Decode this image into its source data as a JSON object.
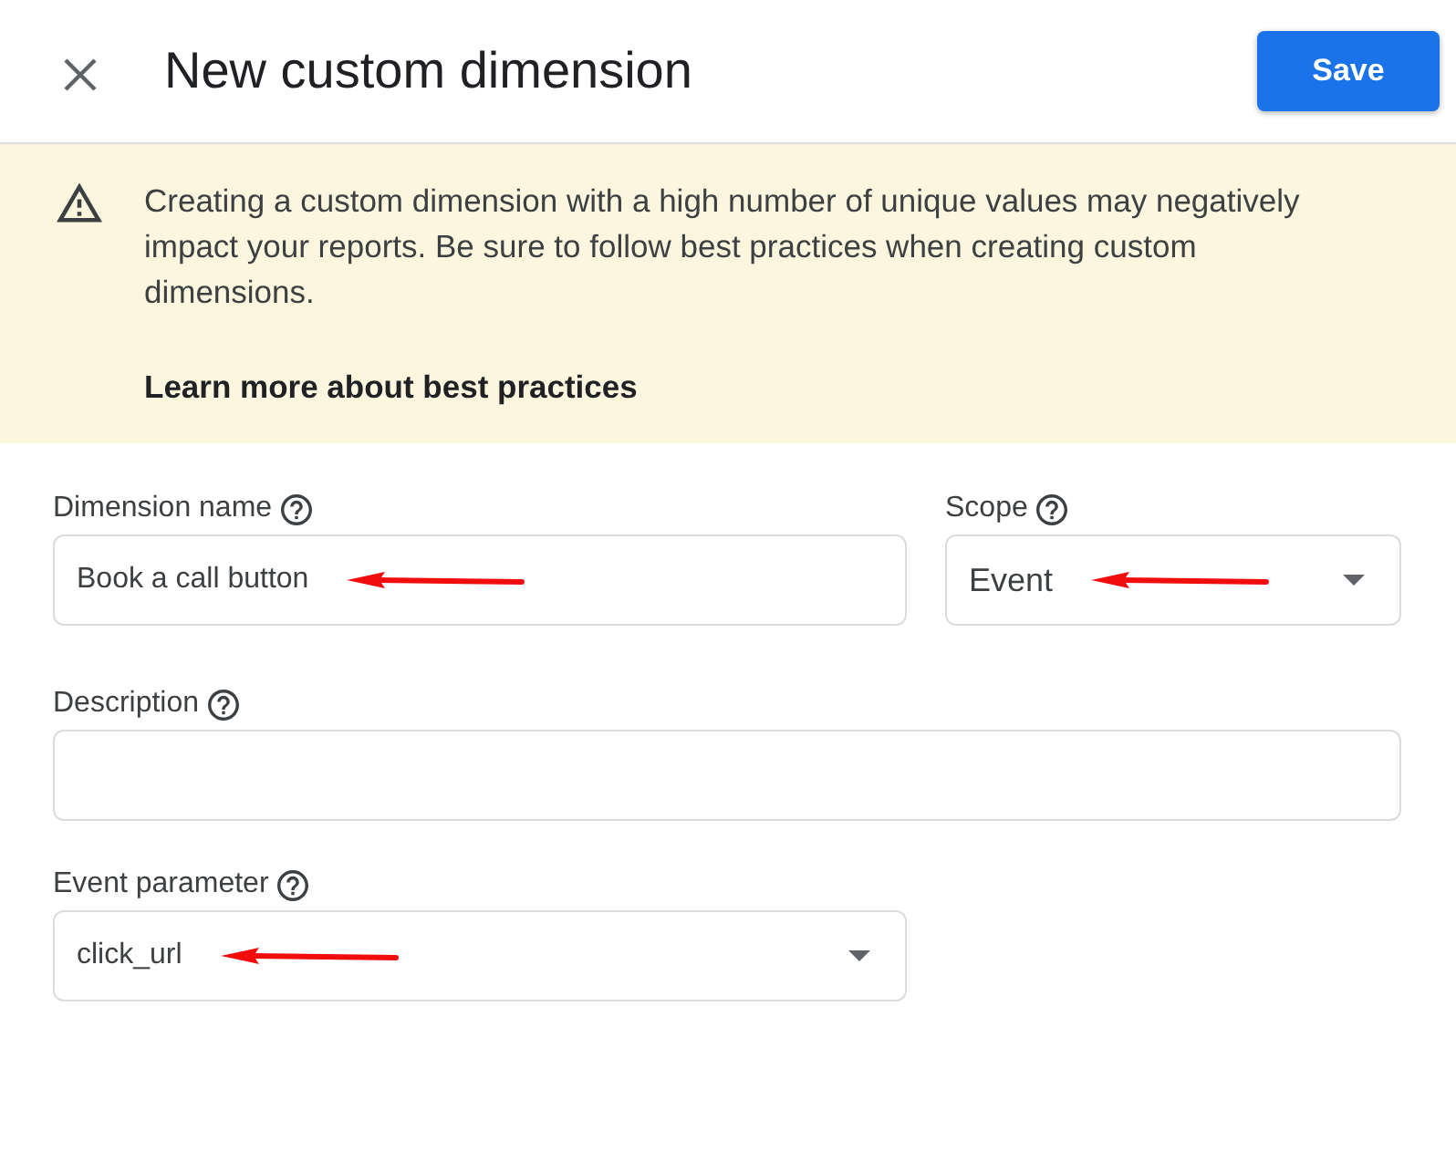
{
  "header": {
    "title": "New custom dimension",
    "save_button": "Save"
  },
  "warning": {
    "message": "Creating a custom dimension with a high number of unique values may negatively impact your reports. Be sure to follow best practices when creating custom dimensions.",
    "link": "Learn more about best practices"
  },
  "fields": [
    {
      "label": "Dimension name",
      "kind": "text",
      "value": "Book a call button",
      "arrow": true
    },
    {
      "label": "Scope",
      "kind": "select",
      "value": "Event",
      "arrow": true
    },
    {
      "label": "Description",
      "kind": "text",
      "arrow": false
    },
    {
      "label": "Event parameter",
      "kind": "select",
      "value": "click_url",
      "arrow": true
    }
  ]
}
